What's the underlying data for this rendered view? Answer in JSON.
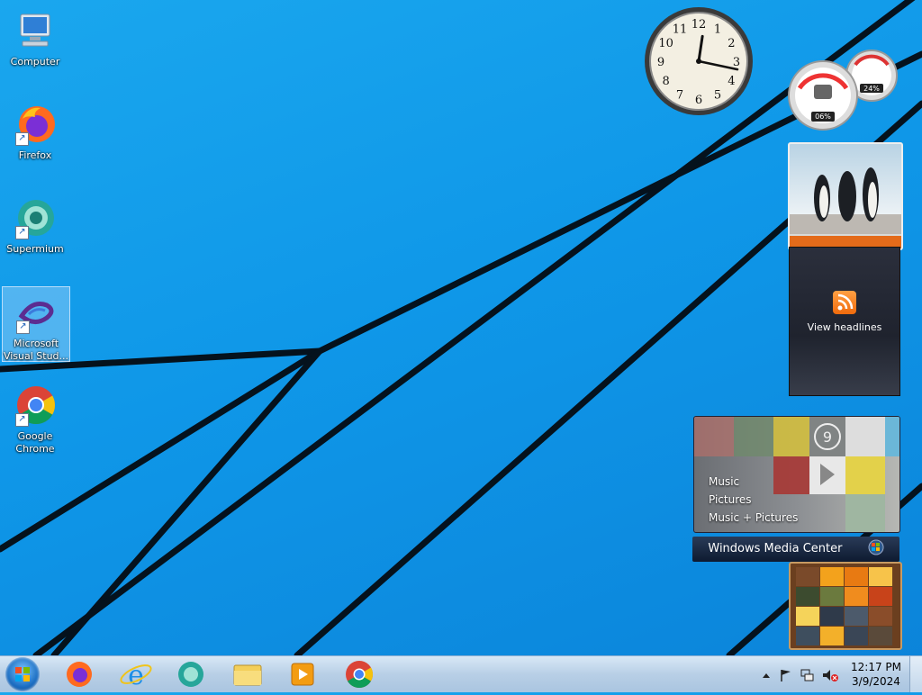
{
  "desktop_icons": [
    {
      "label": "Computer",
      "icon": "computer-icon"
    },
    {
      "label": "Firefox",
      "icon": "firefox-icon"
    },
    {
      "label": "Supermium",
      "icon": "supermium-icon"
    },
    {
      "label": "Microsoft Visual Stud...",
      "icon": "visual-studio-icon"
    },
    {
      "label": "Google Chrome",
      "icon": "chrome-icon"
    }
  ],
  "gadgets": {
    "clock": {
      "hour": 12,
      "minute": 17,
      "numbers": [
        "12",
        "1",
        "2",
        "3",
        "4",
        "5",
        "6",
        "7",
        "8",
        "9",
        "10",
        "11"
      ]
    },
    "cpu_meter": {
      "cpu": "06%",
      "memory": "24%"
    },
    "feed": {
      "label": "View headlines"
    },
    "media_center": {
      "items": [
        "Music",
        "Pictures",
        "Music + Pictures"
      ],
      "title": "Windows Media Center"
    }
  },
  "taskbar": {
    "pinned": [
      "ie-icon",
      "firefox-icon",
      "supermium-icon",
      "explorer-icon",
      "media-player-icon",
      "chrome-icon"
    ],
    "time": "12:17 PM",
    "date": "3/9/2024"
  },
  "colors": {
    "wallpaper": "#0f97e8",
    "accent_orange": "#e46b1a"
  }
}
